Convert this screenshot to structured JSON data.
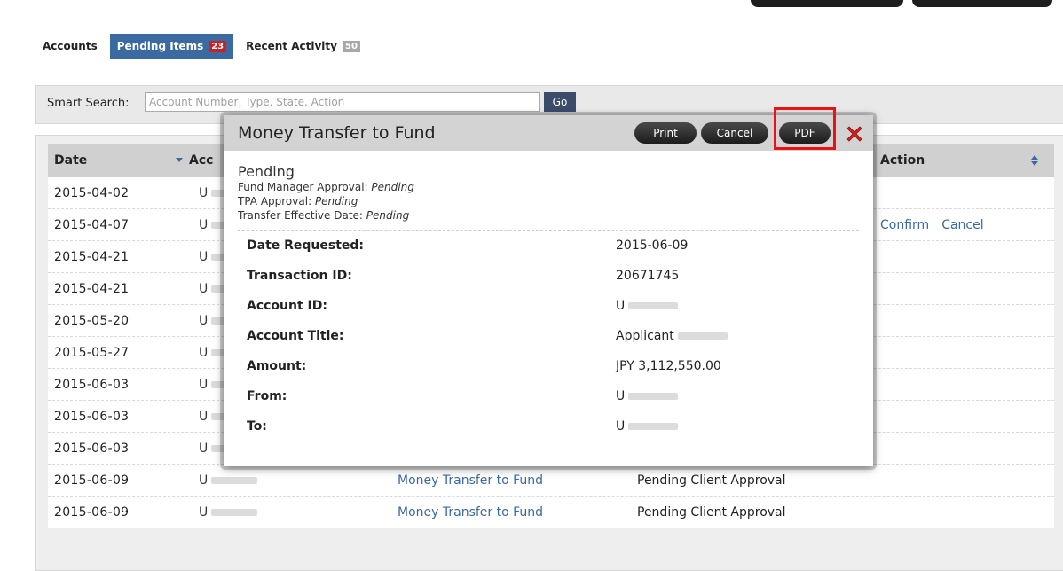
{
  "tabs": [
    {
      "label": "Accounts",
      "badge": ""
    },
    {
      "label": "Pending Items",
      "badge": "23"
    },
    {
      "label": "Recent Activity",
      "badge": "50"
    }
  ],
  "search": {
    "label": "Smart Search:",
    "placeholder": "Account Number, Type, State, Action",
    "go_label": "Go"
  },
  "table": {
    "headers": {
      "date": "Date",
      "account": "Acc",
      "action": "Action"
    },
    "rows": [
      {
        "date": "2015-04-02",
        "account": "U",
        "type": "",
        "status": "",
        "action": []
      },
      {
        "date": "2015-04-07",
        "account": "U",
        "type": "",
        "status": "",
        "action": [
          "Confirm",
          "Cancel"
        ]
      },
      {
        "date": "2015-04-21",
        "account": "U",
        "type": "",
        "status": "",
        "action": []
      },
      {
        "date": "2015-04-21",
        "account": "U",
        "type": "",
        "status": "",
        "action": []
      },
      {
        "date": "2015-05-20",
        "account": "U",
        "type": "",
        "status": "",
        "action": []
      },
      {
        "date": "2015-05-27",
        "account": "U",
        "type": "",
        "status": "",
        "action": []
      },
      {
        "date": "2015-06-03",
        "account": "U",
        "type": "",
        "status": "",
        "action": []
      },
      {
        "date": "2015-06-03",
        "account": "U",
        "type": "",
        "status": "",
        "action": []
      },
      {
        "date": "2015-06-03",
        "account": "U",
        "type": "",
        "status": "",
        "action": []
      },
      {
        "date": "2015-06-09",
        "account": "U",
        "type": "Money Transfer to Fund",
        "status": "Pending Client Approval",
        "action": []
      },
      {
        "date": "2015-06-09",
        "account": "U",
        "type": "Money Transfer to Fund",
        "status": "Pending Client Approval",
        "action": []
      }
    ]
  },
  "modal": {
    "title": "Money Transfer to Fund",
    "buttons": {
      "print": "Print",
      "cancel": "Cancel",
      "pdf": "PDF"
    },
    "status": "Pending",
    "approvals": [
      {
        "label": "Fund Manager Approval:",
        "value": "Pending"
      },
      {
        "label": "TPA Approval:",
        "value": "Pending"
      },
      {
        "label": "Transfer Effective Date:",
        "value": "Pending"
      }
    ],
    "details": [
      {
        "label": "Date Requested:",
        "value": "2015-06-09"
      },
      {
        "label": "Transaction ID:",
        "value": "20671745"
      },
      {
        "label": "Account ID:",
        "value": "U"
      },
      {
        "label": "Account Title:",
        "value": "Applicant"
      },
      {
        "label": "Amount:",
        "value": "JPY 3,112,550.00"
      },
      {
        "label": "From:",
        "value": "U"
      },
      {
        "label": "To:",
        "value": "U"
      }
    ]
  },
  "colors": {
    "accent_blue": "#3b6aa0",
    "badge_red": "#c62424",
    "highlight_red": "#e11111",
    "close_red": "#d42020"
  }
}
